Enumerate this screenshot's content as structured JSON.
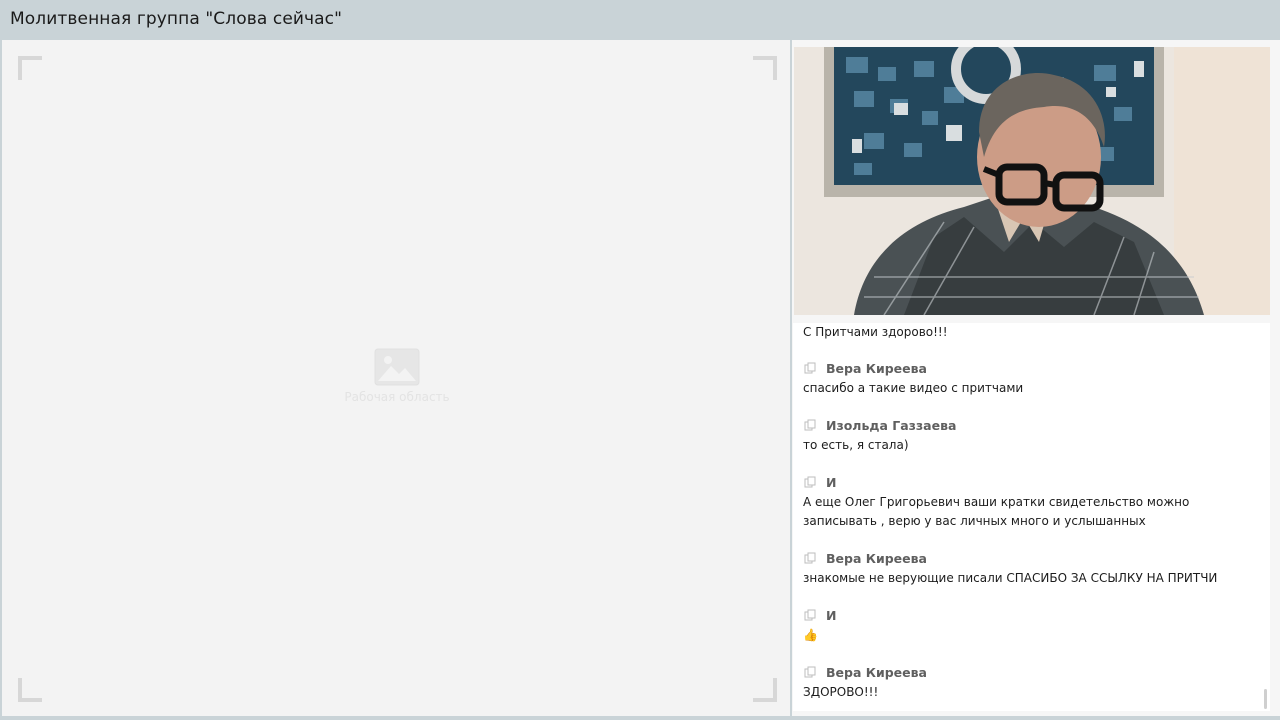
{
  "window": {
    "title": "Молитвенная группа \"Слова сейчас\""
  },
  "workspace": {
    "placeholder_label": "Рабочая область",
    "placeholder_icon": "image-icon"
  },
  "video": {
    "description_icon": "webcam-feed"
  },
  "chat": {
    "first_text": "С Притчами здорово!!!",
    "messages": [
      {
        "author": "Вера Киреева",
        "text": "спасибо а такие видео с притчами"
      },
      {
        "author": "Изольда Газзаева",
        "text": "то есть, я стала)"
      },
      {
        "author": "И",
        "text": "А еще Олег Григорьевич ваши кратки свидетельство можно записывать , верю у вас личных много и услышанных"
      },
      {
        "author": "Вера Киреева",
        "text": "знакомые не верующие писали СПАСИБО ЗА ССЫЛКУ НА ПРИТЧИ"
      },
      {
        "author": "И",
        "text": "👍"
      },
      {
        "author": "Вера Киреева",
        "text": "ЗДОРОВО!!!"
      }
    ]
  },
  "colors": {
    "titlebar_bg": "#c9d3d7",
    "workspace_bg": "#f3f3f3",
    "author_color": "#5f5f5f"
  }
}
